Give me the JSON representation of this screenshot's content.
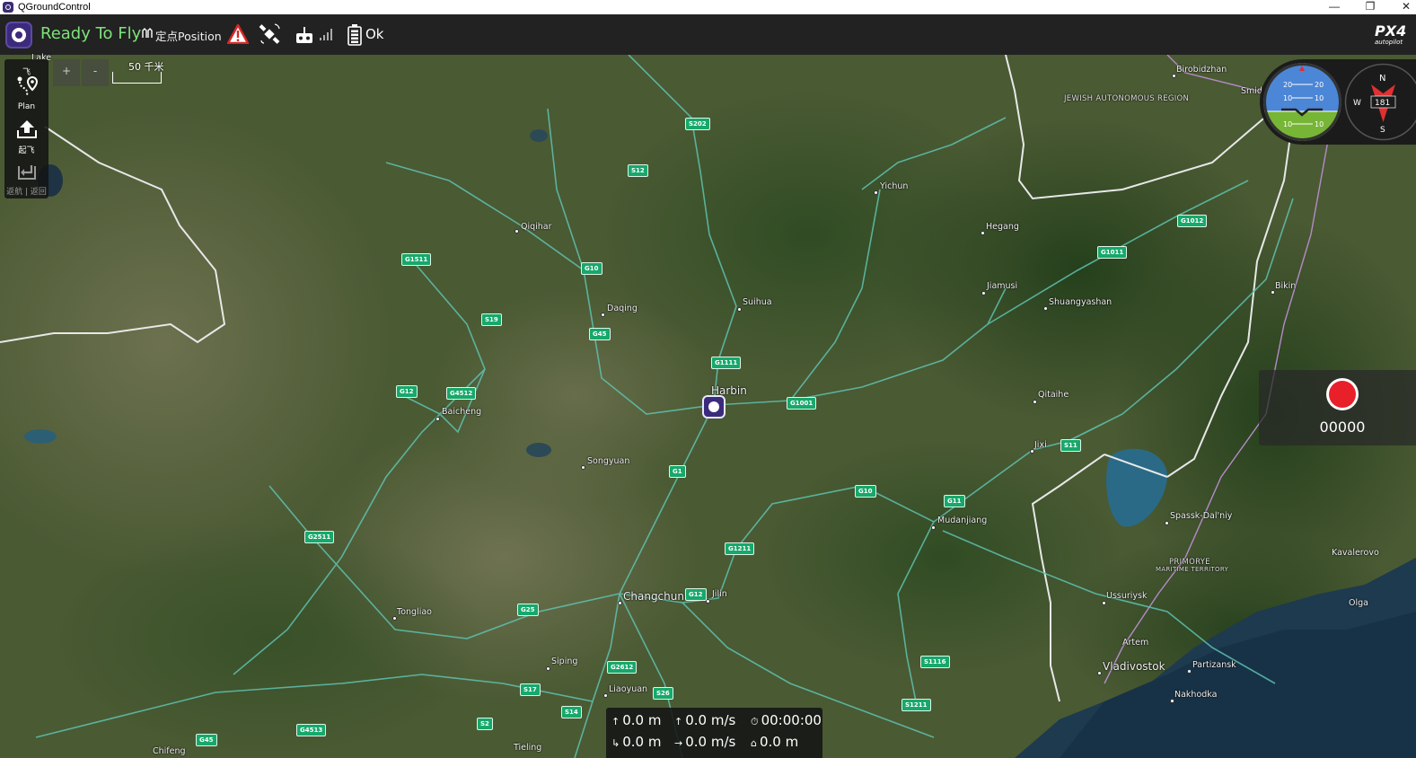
{
  "window": {
    "title": "QGroundControl",
    "minimize_icon": "minimize-icon",
    "restore_icon": "restore-icon",
    "close_icon": "close-icon",
    "minimize_glyph": "—",
    "restore_glyph": "❐",
    "close_glyph": "✕"
  },
  "toolbar": {
    "status": "Ready To Fly",
    "mode": "定点Position",
    "battery": "Ok",
    "status_color": "#7ee27a",
    "icons": [
      "qgc-logo-icon",
      "flight-mode-icon",
      "warning-icon",
      "gps-satellite-icon",
      "rc-transmitter-icon",
      "signal-bars-icon",
      "battery-icon",
      "px4-logo-icon"
    ]
  },
  "toolstrip": {
    "header": "飞",
    "plan": "Plan",
    "takeoff": "起飞",
    "return": "返航 | 返回"
  },
  "zoom": {
    "zoom_in": "+",
    "zoom_out": "-"
  },
  "scale": {
    "text": "50 千米"
  },
  "map": {
    "cities": {
      "birobidzhan": "Birobidzhan",
      "smid": "Smid",
      "yichun": "Yichun",
      "qiqihar": "Qiqihar",
      "hegang": "Hegang",
      "daqing": "Daqing",
      "suihua": "Suihua",
      "jiamusi": "Jiamusi",
      "shuangyashan": "Shuangyashan",
      "bikin": "Bikin",
      "harbin": "Harbin",
      "qitaihe": "Qitaihe",
      "baicheng": "Baicheng",
      "jixi": "Jixi",
      "songyuan": "Songyuan",
      "mudanjiang": "Mudanjiang",
      "spassk": "Spassk-Dal'niy",
      "kavalerovo": "Kavalerovo",
      "changchun": "Changchun",
      "jilin": "Jilin",
      "ussuriysk": "Ussuriysk",
      "olga": "Olga",
      "tongliao": "Tongliao",
      "artem": "Artem",
      "siping": "Siping",
      "vladivostok": "Vladivostok",
      "partizansk": "Partizansk",
      "liaoyuan": "Liaoyuan",
      "nakhodka": "Nakhodka",
      "chifeng": "Chifeng",
      "tieling": "Tieling",
      "lake": "Lake"
    },
    "regions": {
      "jewish": "JEWISH AUTONOMOUS REGION",
      "primorye1": "PRIMORYE",
      "primorye2": "MARITIME TERRITORY"
    },
    "shields": [
      "S202",
      "S12",
      "G1012",
      "G1011",
      "G1511",
      "G10",
      "S19",
      "G45",
      "G1111",
      "G12",
      "G4512",
      "G1001",
      "S11",
      "G1",
      "G10",
      "G11",
      "G2511",
      "G1211",
      "G12",
      "G25",
      "G2612",
      "S17",
      "S26",
      "S14",
      "S2",
      "G4513",
      "G45",
      "S1116",
      "S1211"
    ]
  },
  "instruments": {
    "pitch_labels": [
      "20",
      "20",
      "10",
      "10",
      "10",
      "10"
    ],
    "compass_north": "N",
    "compass_west": "W",
    "compass_south": "S",
    "heading": "181",
    "sky_color": "#4c86d6",
    "ground_color": "#77b536"
  },
  "record": {
    "time": "00000",
    "button_color": "#e8202a"
  },
  "telemetry": {
    "altitude": "0.0 m",
    "vertical_speed": "0.0 m/s",
    "flight_time": "00:00:00",
    "distance": "0.0 m",
    "horizontal_speed": "0.0 m/s",
    "home_distance": "0.0 m",
    "altitude_icon": "↑",
    "vspeed_icon": "↑",
    "time_icon": "⏱",
    "distance_icon": "↳",
    "hspeed_icon": "→",
    "home_icon": "⌂"
  }
}
